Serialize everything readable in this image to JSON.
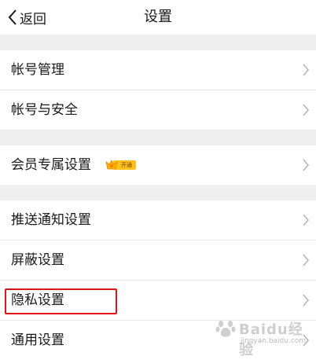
{
  "header": {
    "back_label": "返回",
    "title": "设置"
  },
  "settings": {
    "account_manage": "帐号管理",
    "account_security": "帐号与安全",
    "member_settings": "会员专属设置",
    "member_badge": "开通",
    "push_settings": "推送通知设置",
    "block_settings": "屏蔽设置",
    "privacy_settings": "隐私设置",
    "general_settings": "通用设置"
  },
  "watermark": {
    "text": "Baidu经验",
    "sub": "jingyan.baidu.com"
  },
  "colors": {
    "highlight": "#e0131d",
    "badge": "#ffc21a",
    "background": "#efefef"
  }
}
